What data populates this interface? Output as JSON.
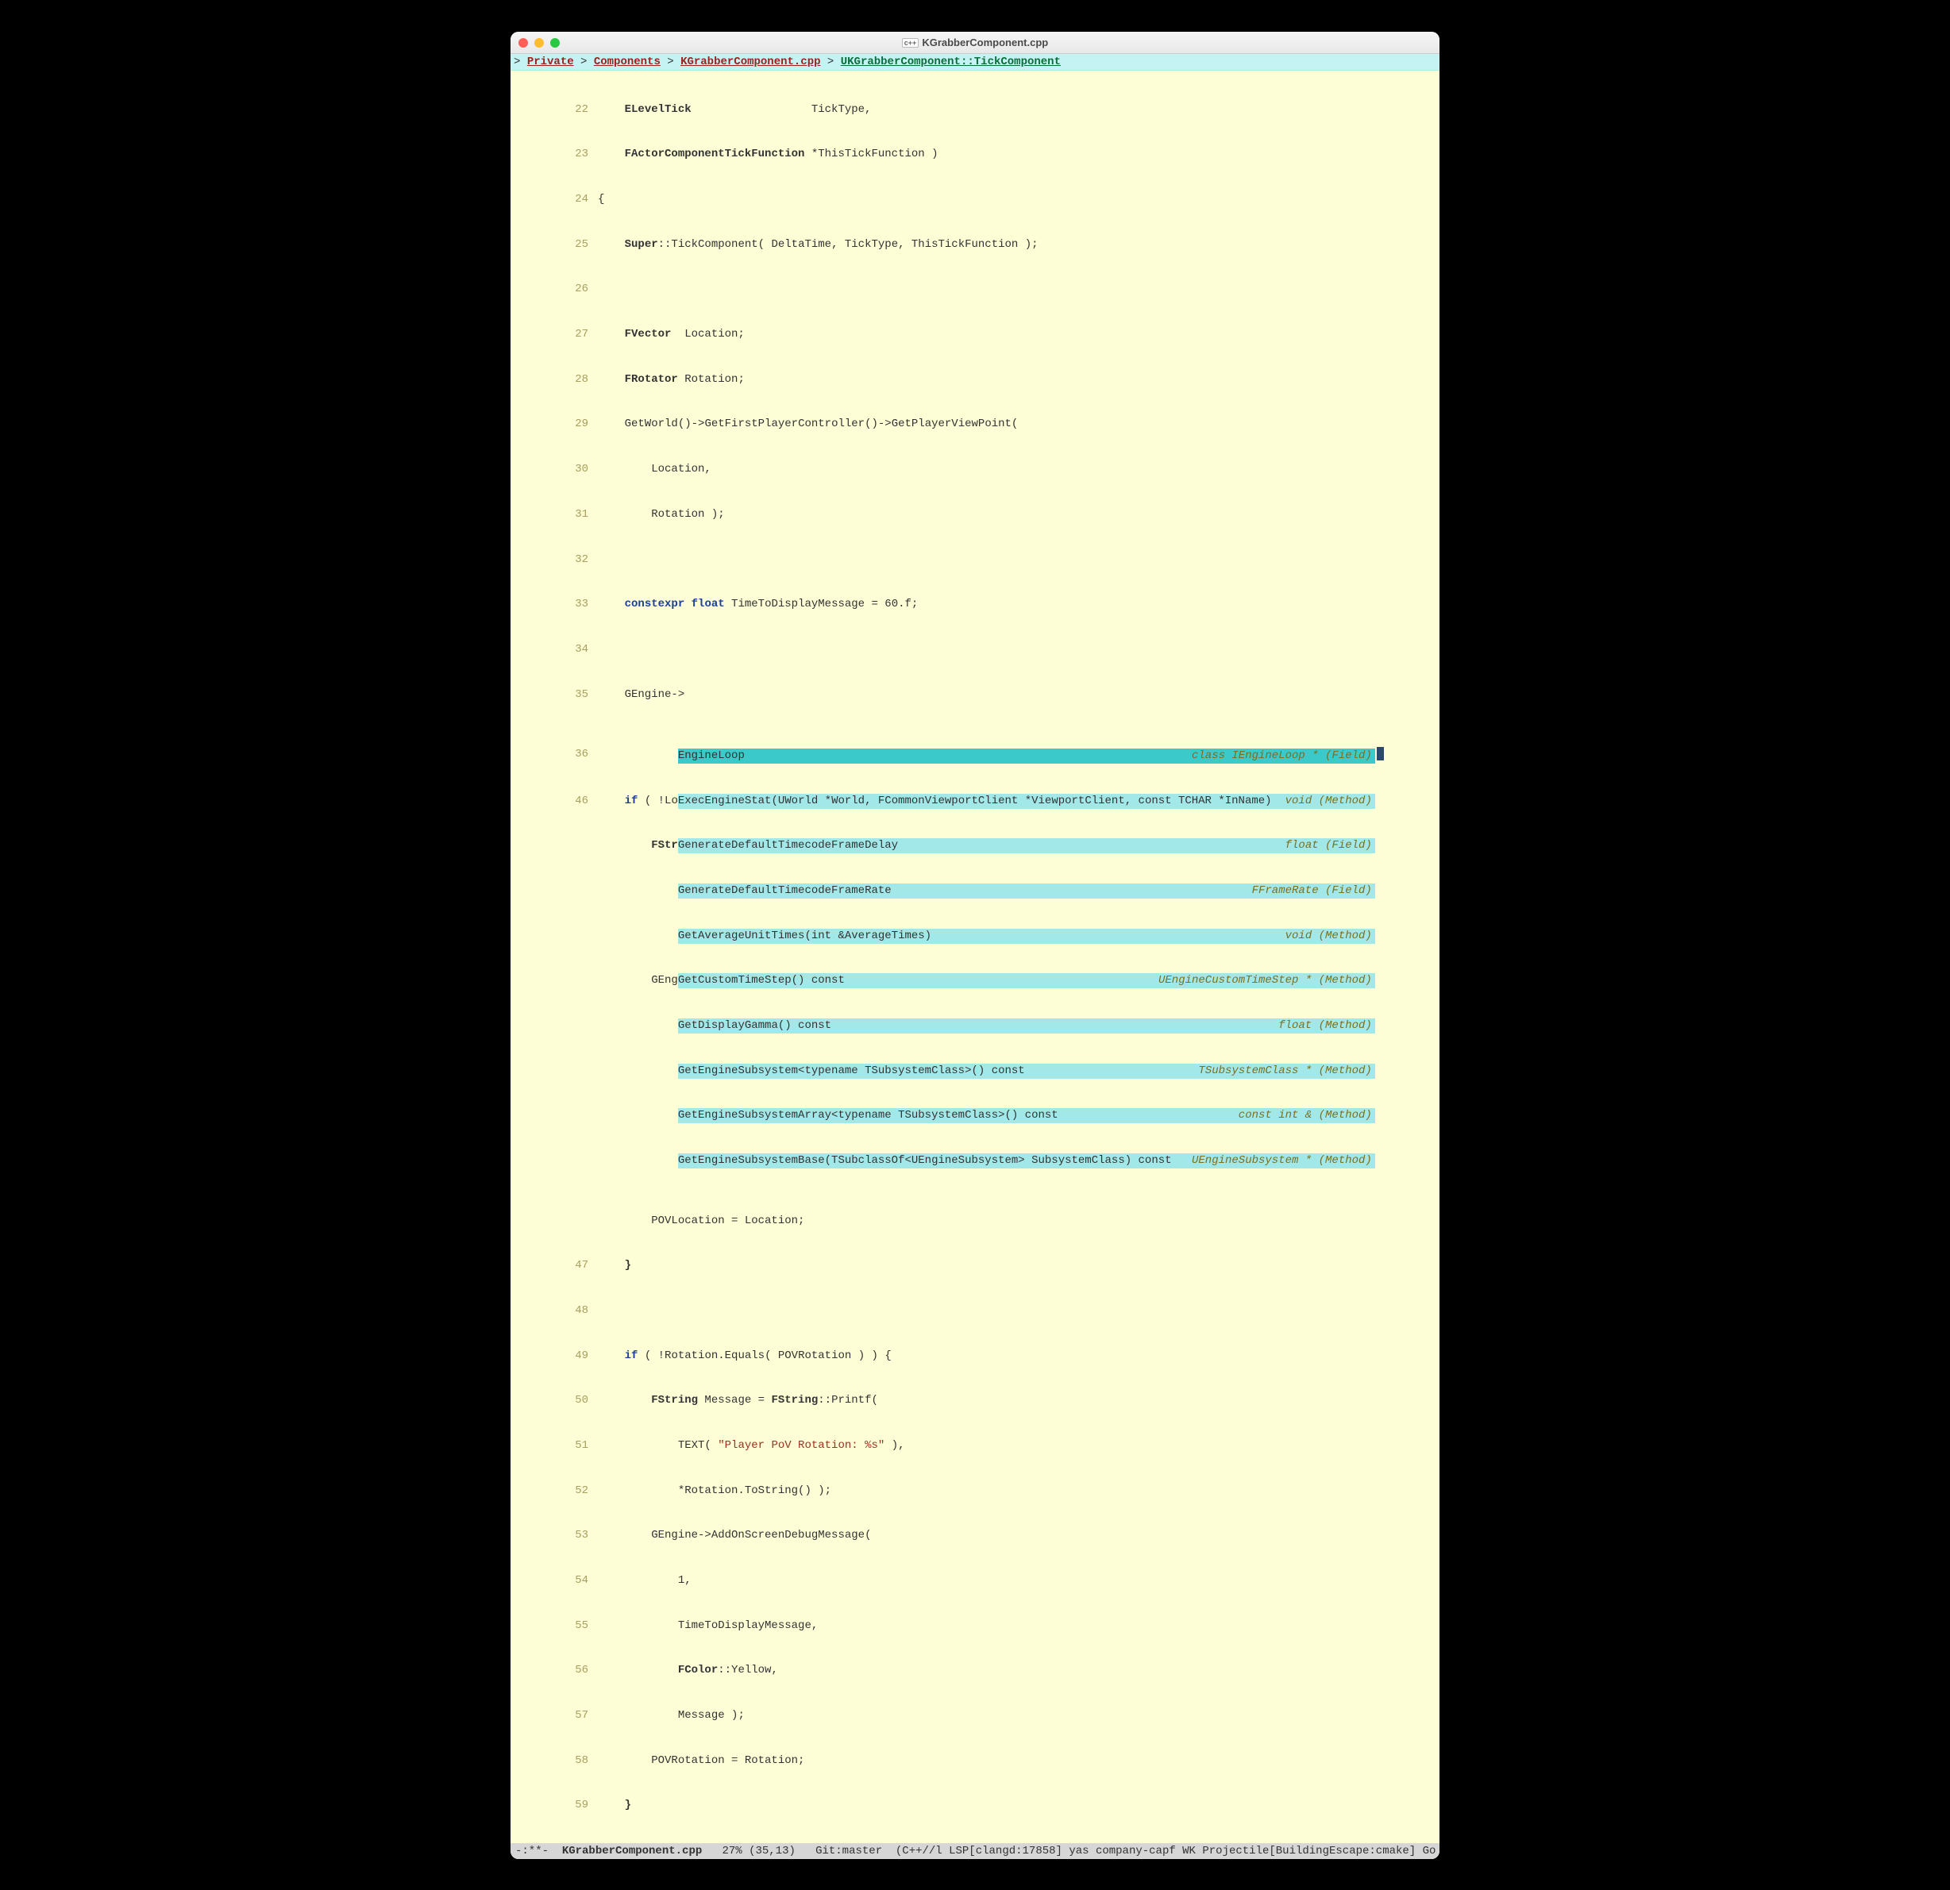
{
  "window": {
    "title": "KGrabberComponent.cpp",
    "icon_label": "c++"
  },
  "breadcrumb": {
    "items": [
      "Private",
      "Components",
      "KGrabberComponent.cpp",
      "UKGrabberComponent::TickComponent"
    ]
  },
  "lines": [
    {
      "n": "22",
      "code": "    ELevelTick                  TickType,"
    },
    {
      "n": "23",
      "code": "    FActorComponentTickFunction *ThisTickFunction )"
    },
    {
      "n": "24",
      "code": "{"
    },
    {
      "n": "25",
      "code": "    Super::TickComponent( DeltaTime, TickType, ThisTickFunction );"
    },
    {
      "n": "26",
      "code": ""
    },
    {
      "n": "27",
      "code": "    FVector  Location;"
    },
    {
      "n": "28",
      "code": "    FRotator Rotation;"
    },
    {
      "n": "29",
      "code": "    GetWorld()->GetFirstPlayerController()->GetPlayerViewPoint("
    },
    {
      "n": "30",
      "code": "        Location,"
    },
    {
      "n": "31",
      "code": "        Rotation );"
    },
    {
      "n": "32",
      "code": ""
    },
    {
      "n": "33",
      "code": "    constexpr float TimeToDisplayMessage = 60.f;"
    },
    {
      "n": "34",
      "code": ""
    },
    {
      "n": "35",
      "code": "    GEngine->"
    },
    {
      "n": "36",
      "code": "            "
    },
    {
      "n": "46",
      "code": "    if ( !Lo"
    },
    {
      "n": "",
      "code": "        FStr"
    },
    {
      "n": "",
      "code": "            "
    },
    {
      "n": "",
      "code": "            "
    },
    {
      "n": "",
      "code": "        GEng"
    },
    {
      "n": "",
      "code": "            "
    },
    {
      "n": "",
      "code": "            "
    },
    {
      "n": "",
      "code": "            "
    },
    {
      "n": "",
      "code": "            "
    },
    {
      "n": "",
      "code": "        POVLocation = Location;"
    },
    {
      "n": "47",
      "code": "    }"
    },
    {
      "n": "48",
      "code": ""
    },
    {
      "n": "49",
      "code": "    if ( !Rotation.Equals( POVRotation ) ) {"
    },
    {
      "n": "50",
      "code": "        FString Message = FString::Printf("
    },
    {
      "n": "51",
      "code": "            TEXT( \"Player PoV Rotation: %s\" ),"
    },
    {
      "n": "52",
      "code": "            *Rotation.ToString() );"
    },
    {
      "n": "53",
      "code": "        GEngine->AddOnScreenDebugMessage("
    },
    {
      "n": "54",
      "code": "            1,"
    },
    {
      "n": "55",
      "code": "            TimeToDisplayMessage,"
    },
    {
      "n": "56",
      "code": "            FColor::Yellow,"
    },
    {
      "n": "57",
      "code": "            Message );"
    },
    {
      "n": "58",
      "code": "        POVRotation = Rotation;"
    },
    {
      "n": "59",
      "code": "    }"
    }
  ],
  "autocomplete": [
    {
      "label": "EngineLoop",
      "type": "class IEngineLoop * (Field)",
      "selected": true
    },
    {
      "label": "ExecEngineStat(UWorld *World, FCommonViewportClient *ViewportClient, const TCHAR *InName)",
      "type": "void (Method)"
    },
    {
      "label": "GenerateDefaultTimecodeFrameDelay",
      "type": "float (Field)"
    },
    {
      "label": "GenerateDefaultTimecodeFrameRate",
      "type": "FFrameRate (Field)"
    },
    {
      "label": "GetAverageUnitTimes(int &AverageTimes)",
      "type": "void (Method)"
    },
    {
      "label": "GetCustomTimeStep() const",
      "type": "UEngineCustomTimeStep * (Method)"
    },
    {
      "label": "GetDisplayGamma() const",
      "type": "float (Method)"
    },
    {
      "label": "GetEngineSubsystem<typename TSubsystemClass>() const",
      "type": "TSubsystemClass * (Method)"
    },
    {
      "label": "GetEngineSubsystemArray<typename TSubsystemClass>() const",
      "type": "const int & (Method)"
    },
    {
      "label": "GetEngineSubsystemBase(TSubclassOf<UEngineSubsystem> SubsystemClass) const",
      "type": "UEngineSubsystem * (Method)"
    }
  ],
  "modeline": {
    "left": "-:**-  ",
    "filename": "KGrabberComponent.cpp",
    "percent": "   27% ",
    "pos": "(35,13)",
    "git": "   Git:master",
    "modes": "  (C++//l LSP[clangd:17858] yas company-capf WK Projectile[BuildingEscape:cmake] Go"
  }
}
